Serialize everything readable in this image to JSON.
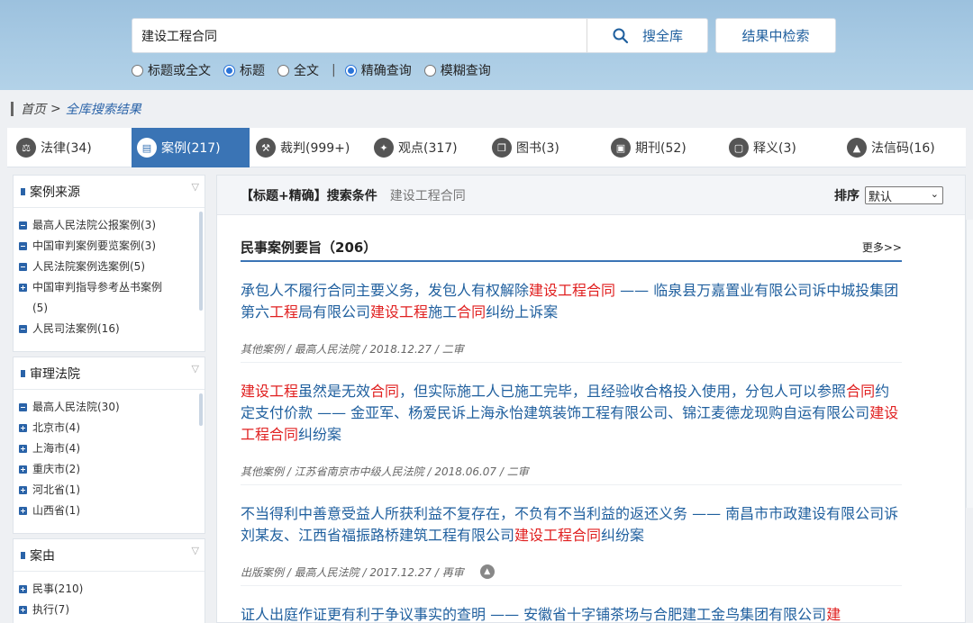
{
  "search": {
    "query": "建设工程合同",
    "search_all_label": "搜全库",
    "search_in_results_label": "结果中检索"
  },
  "options": {
    "scope": [
      {
        "label": "标题或全文",
        "checked": false
      },
      {
        "label": "标题",
        "checked": true
      },
      {
        "label": "全文",
        "checked": false
      }
    ],
    "separator": "|",
    "mode": [
      {
        "label": "精确查询",
        "checked": true
      },
      {
        "label": "模糊查询",
        "checked": false
      }
    ]
  },
  "breadcrumb": {
    "home": "首页",
    "sep": ">",
    "current": "全库搜索结果"
  },
  "tabs": [
    {
      "label": "法律(34)",
      "icon": "scale-icon",
      "glyph": "⚖",
      "active": false
    },
    {
      "label": "案例(217)",
      "icon": "case-icon",
      "glyph": "▤",
      "active": true
    },
    {
      "label": "裁判(999+)",
      "icon": "gavel-icon",
      "glyph": "⚒",
      "active": false
    },
    {
      "label": "观点(317)",
      "icon": "bulb-icon",
      "glyph": "✦",
      "active": false
    },
    {
      "label": "图书(3)",
      "icon": "book-icon",
      "glyph": "❐",
      "active": false
    },
    {
      "label": "期刊(52)",
      "icon": "journal-icon",
      "glyph": "▣",
      "active": false
    },
    {
      "label": "释义(3)",
      "icon": "doc-icon",
      "glyph": "▢",
      "active": false
    },
    {
      "label": "法信码(16)",
      "icon": "code-icon",
      "glyph": "▲",
      "active": false
    }
  ],
  "sidebar": {
    "source": {
      "title": "案例来源",
      "items": [
        {
          "label": "最高人民法院公报案例(3)",
          "expand": false
        },
        {
          "label": "中国审判案例要览案例(3)",
          "expand": false
        },
        {
          "label": "人民法院案例选案例(5)",
          "expand": false
        },
        {
          "label": "中国审判指导参考丛书案例",
          "extra": "(5)",
          "expand": true
        },
        {
          "label": "人民司法案例(16)",
          "expand": false
        }
      ]
    },
    "court": {
      "title": "审理法院",
      "items": [
        {
          "label": "最高人民法院(30)",
          "expand": false
        },
        {
          "label": "北京市(4)",
          "expand": true
        },
        {
          "label": "上海市(4)",
          "expand": true
        },
        {
          "label": "重庆市(2)",
          "expand": true
        },
        {
          "label": "河北省(1)",
          "expand": true
        },
        {
          "label": "山西省(1)",
          "expand": true
        }
      ]
    },
    "cause": {
      "title": "案由",
      "items": [
        {
          "label": "民事(210)",
          "expand": true
        },
        {
          "label": "执行(7)",
          "expand": true
        }
      ]
    }
  },
  "main": {
    "condition_label": "【标题+精确】搜索条件",
    "condition_value": "建设工程合同",
    "sort_label": "排序",
    "sort_value": "默认",
    "section_title": "民事案例要旨（206）",
    "more_label": "更多>>",
    "cases": [
      {
        "title_parts": [
          {
            "t": "承包人不履行合同主要义务，发包人有权解除",
            "hl": false
          },
          {
            "t": "建设工程合同",
            "hl": true
          },
          {
            "t": " —— 临泉县万嘉置业有限公司诉中城投集团第六",
            "hl": false
          },
          {
            "t": "工程",
            "hl": true
          },
          {
            "t": "局有限公司",
            "hl": false
          },
          {
            "t": "建设工程",
            "hl": true
          },
          {
            "t": "施工",
            "hl": false
          },
          {
            "t": "合同",
            "hl": true
          },
          {
            "t": "纠纷上诉案",
            "hl": false
          }
        ],
        "meta": "其他案例 / 最高人民法院 / 2018.12.27 / 二审",
        "has_icon": false
      },
      {
        "title_parts": [
          {
            "t": "建设工程",
            "hl": true
          },
          {
            "t": "虽然是无效",
            "hl": false
          },
          {
            "t": "合同",
            "hl": true
          },
          {
            "t": "，但实际施工人已施工完毕，且经验收合格投入使用，分包人可以参照",
            "hl": false
          },
          {
            "t": "合同",
            "hl": true
          },
          {
            "t": "约定支付价款 —— 金亚军、杨爱民诉上海永怡建筑装饰工程有限公司、锦江麦德龙现购自运有限公司",
            "hl": false
          },
          {
            "t": "建设工程合同",
            "hl": true
          },
          {
            "t": "纠纷案",
            "hl": false
          }
        ],
        "meta": "其他案例 / 江苏省南京市中级人民法院 / 2018.06.07 / 二审",
        "has_icon": false
      },
      {
        "title_parts": [
          {
            "t": "不当得利中善意受益人所获利益不复存在，不负有不当利益的返还义务 —— 南昌市市政建设有限公司诉刘某友、江西省福振路桥建筑工程有限公司",
            "hl": false
          },
          {
            "t": "建设工程合同",
            "hl": true
          },
          {
            "t": "纠纷案",
            "hl": false
          }
        ],
        "meta": "出版案例 / 最高人民法院 / 2017.12.27 / 再审",
        "has_icon": true
      },
      {
        "title_parts": [
          {
            "t": "证人出庭作证更有利于争议事实的查明 —— 安徽省十字铺茶场与合肥建工金鸟集团有限公司",
            "hl": false
          },
          {
            "t": "建",
            "hl": true
          }
        ],
        "meta": "",
        "has_icon": false
      }
    ]
  },
  "colors": {
    "header_bg": "#a9cbe4",
    "accent": "#3a74b5",
    "link": "#1f5f9e",
    "highlight": "#e02020"
  }
}
